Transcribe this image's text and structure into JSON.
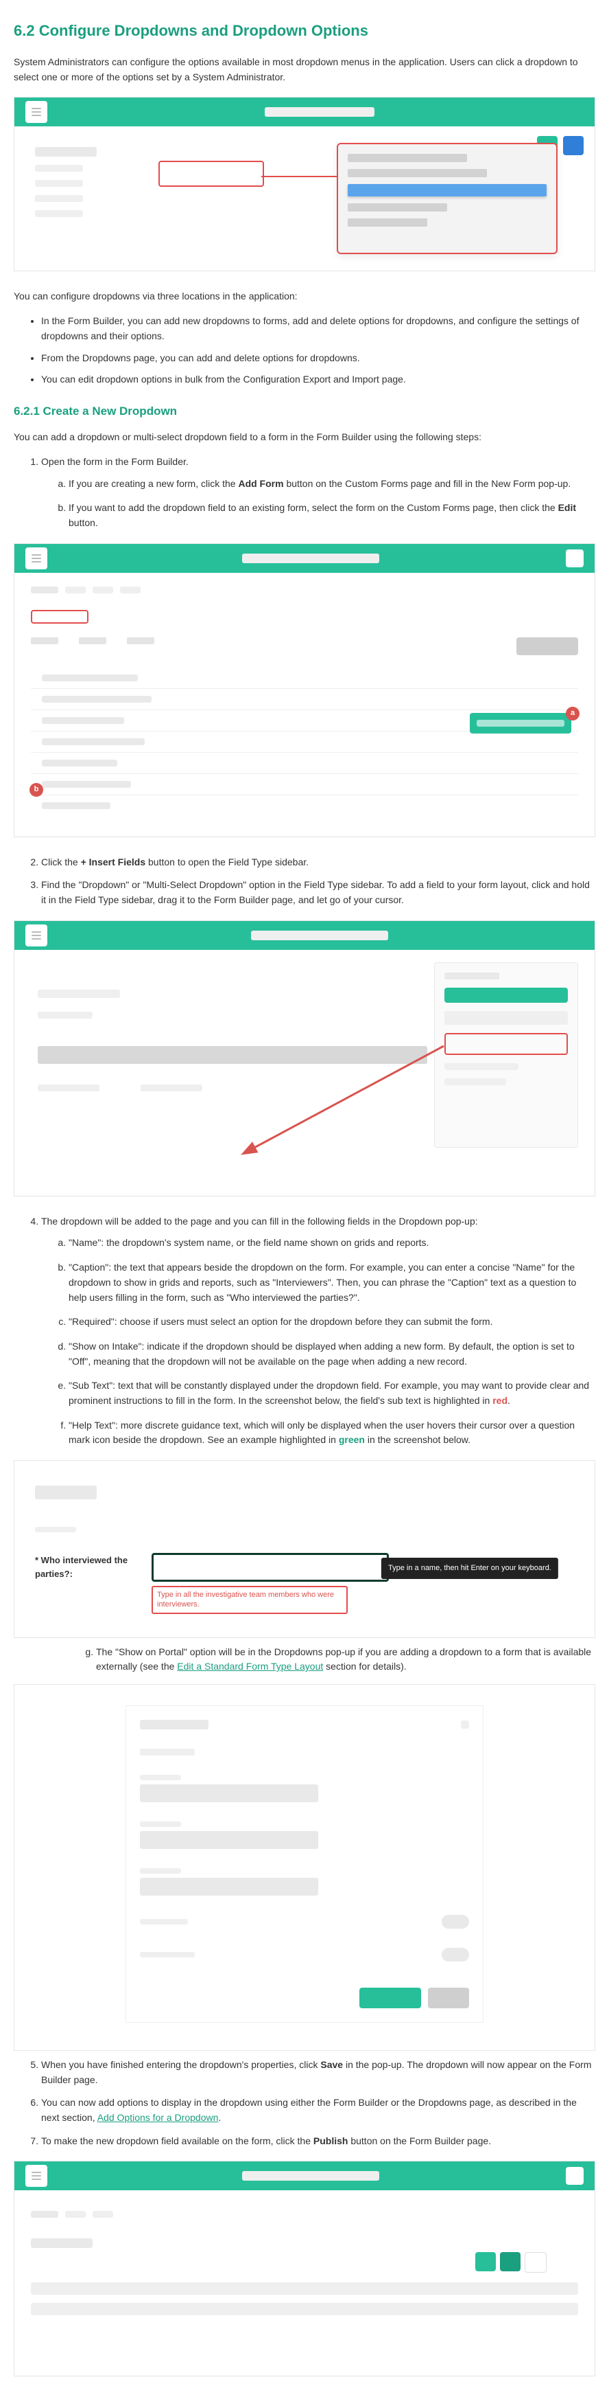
{
  "section": {
    "number": "6.2",
    "title": "6.2 Configure Dropdowns and Dropdown Options",
    "intro": "System Administrators can configure the options available in most dropdown menus in the application. Users can click a dropdown to select one or more of the options set by a System Administrator.",
    "locations_lead": "You can configure dropdowns via three locations in the application:",
    "locations": [
      "In the Form Builder, you can add new dropdowns to forms, add and delete options for dropdowns, and configure the settings of dropdowns and their options.",
      "From the Dropdowns page, you can add and delete options for dropdowns.",
      "You can edit dropdown options in bulk from the Configuration Export and Import page."
    ]
  },
  "sub621": {
    "title": "6.2.1 Create a New Dropdown",
    "intro": "You can add a dropdown or multi-select dropdown field to a form in the Form Builder using the following steps:",
    "step1": {
      "text": "Open the form in the Form Builder.",
      "a": {
        "pre": "If you are creating a new form, click the ",
        "bold": "Add Form",
        "post": " button on the Custom Forms page and fill in the New Form pop-up."
      },
      "b": {
        "pre": "If you want to add the dropdown field to an existing form, select the form on the Custom Forms page, then click the ",
        "bold": "Edit",
        "post": " button."
      }
    },
    "step2": {
      "pre": "Click the ",
      "bold": "+ Insert Fields",
      "post": " button to open the Field Type sidebar."
    },
    "step3": "Find the \"Dropdown\" or \"Multi-Select Dropdown\" option in the Field Type sidebar. To add a field to your form layout, click and hold it in the Field Type sidebar, drag it to the Form Builder page, and let go of your cursor.",
    "step4_lead": "The dropdown will be added to the page and you can fill in the following fields in the Dropdown pop-up:",
    "step4_fields": {
      "a": "\"Name\": the dropdown's system name, or the field name shown on grids and reports.",
      "b": "\"Caption\": the text that appears beside the dropdown on the form. For example, you can enter a concise \"Name\" for the dropdown to show in grids and reports, such as \"Interviewers\". Then, you can phrase the \"Caption\" text as a question to help users filling in the form, such as \"Who interviewed the parties?\".",
      "c": "\"Required\": choose if users must select an option for the dropdown before they can submit the form.",
      "d": "\"Show on Intake\": indicate if the dropdown should be displayed when adding a new form. By default, the option is set to \"Off\", meaning that the dropdown will not be available on the page when adding a new record.",
      "e_pre": "\"Sub Text\": text that will be constantly displayed under the dropdown field. For example, you may want to provide clear and prominent instructions to fill in the form. In the screenshot below, the field's sub text is highlighted in ",
      "e_hl": "red",
      "e_post": ".",
      "f_pre": "\"Help Text\": more discrete guidance text, which will only be displayed when the user hovers their cursor over a question mark icon beside the dropdown. See an example highlighted in ",
      "f_hl": "green",
      "f_post": " in the screenshot below."
    },
    "portal_note_pre": "The \"Show on Portal\" option will be in the Dropdowns pop-up if you are adding a dropdown to a form that is available externally (see the ",
    "portal_note_link": "Edit a Standard Form Type Layout",
    "portal_note_post": " section for details).",
    "step5": {
      "pre": "When you have finished entering the dropdown's properties, click ",
      "bold": "Save",
      "post": " in the pop-up. The dropdown will now appear on the Form Builder page."
    },
    "step6_pre": "You can now add options to display in the dropdown using either the Form Builder or the Dropdowns page, as described in the next section, ",
    "step6_link": "Add Options for a Dropdown",
    "step6_post": ".",
    "step7": {
      "pre": "To make the new dropdown field available on the form, click the ",
      "bold": "Publish",
      "post": " button on the Form Builder page."
    }
  },
  "mock4": {
    "label": "* Who interviewed the parties?:",
    "tooltip": "Type in a name, then hit Enter on your keyboard.",
    "subtext": "Type in all the investigative team members who were interviewers."
  },
  "badges": {
    "a": "a",
    "b": "b"
  }
}
